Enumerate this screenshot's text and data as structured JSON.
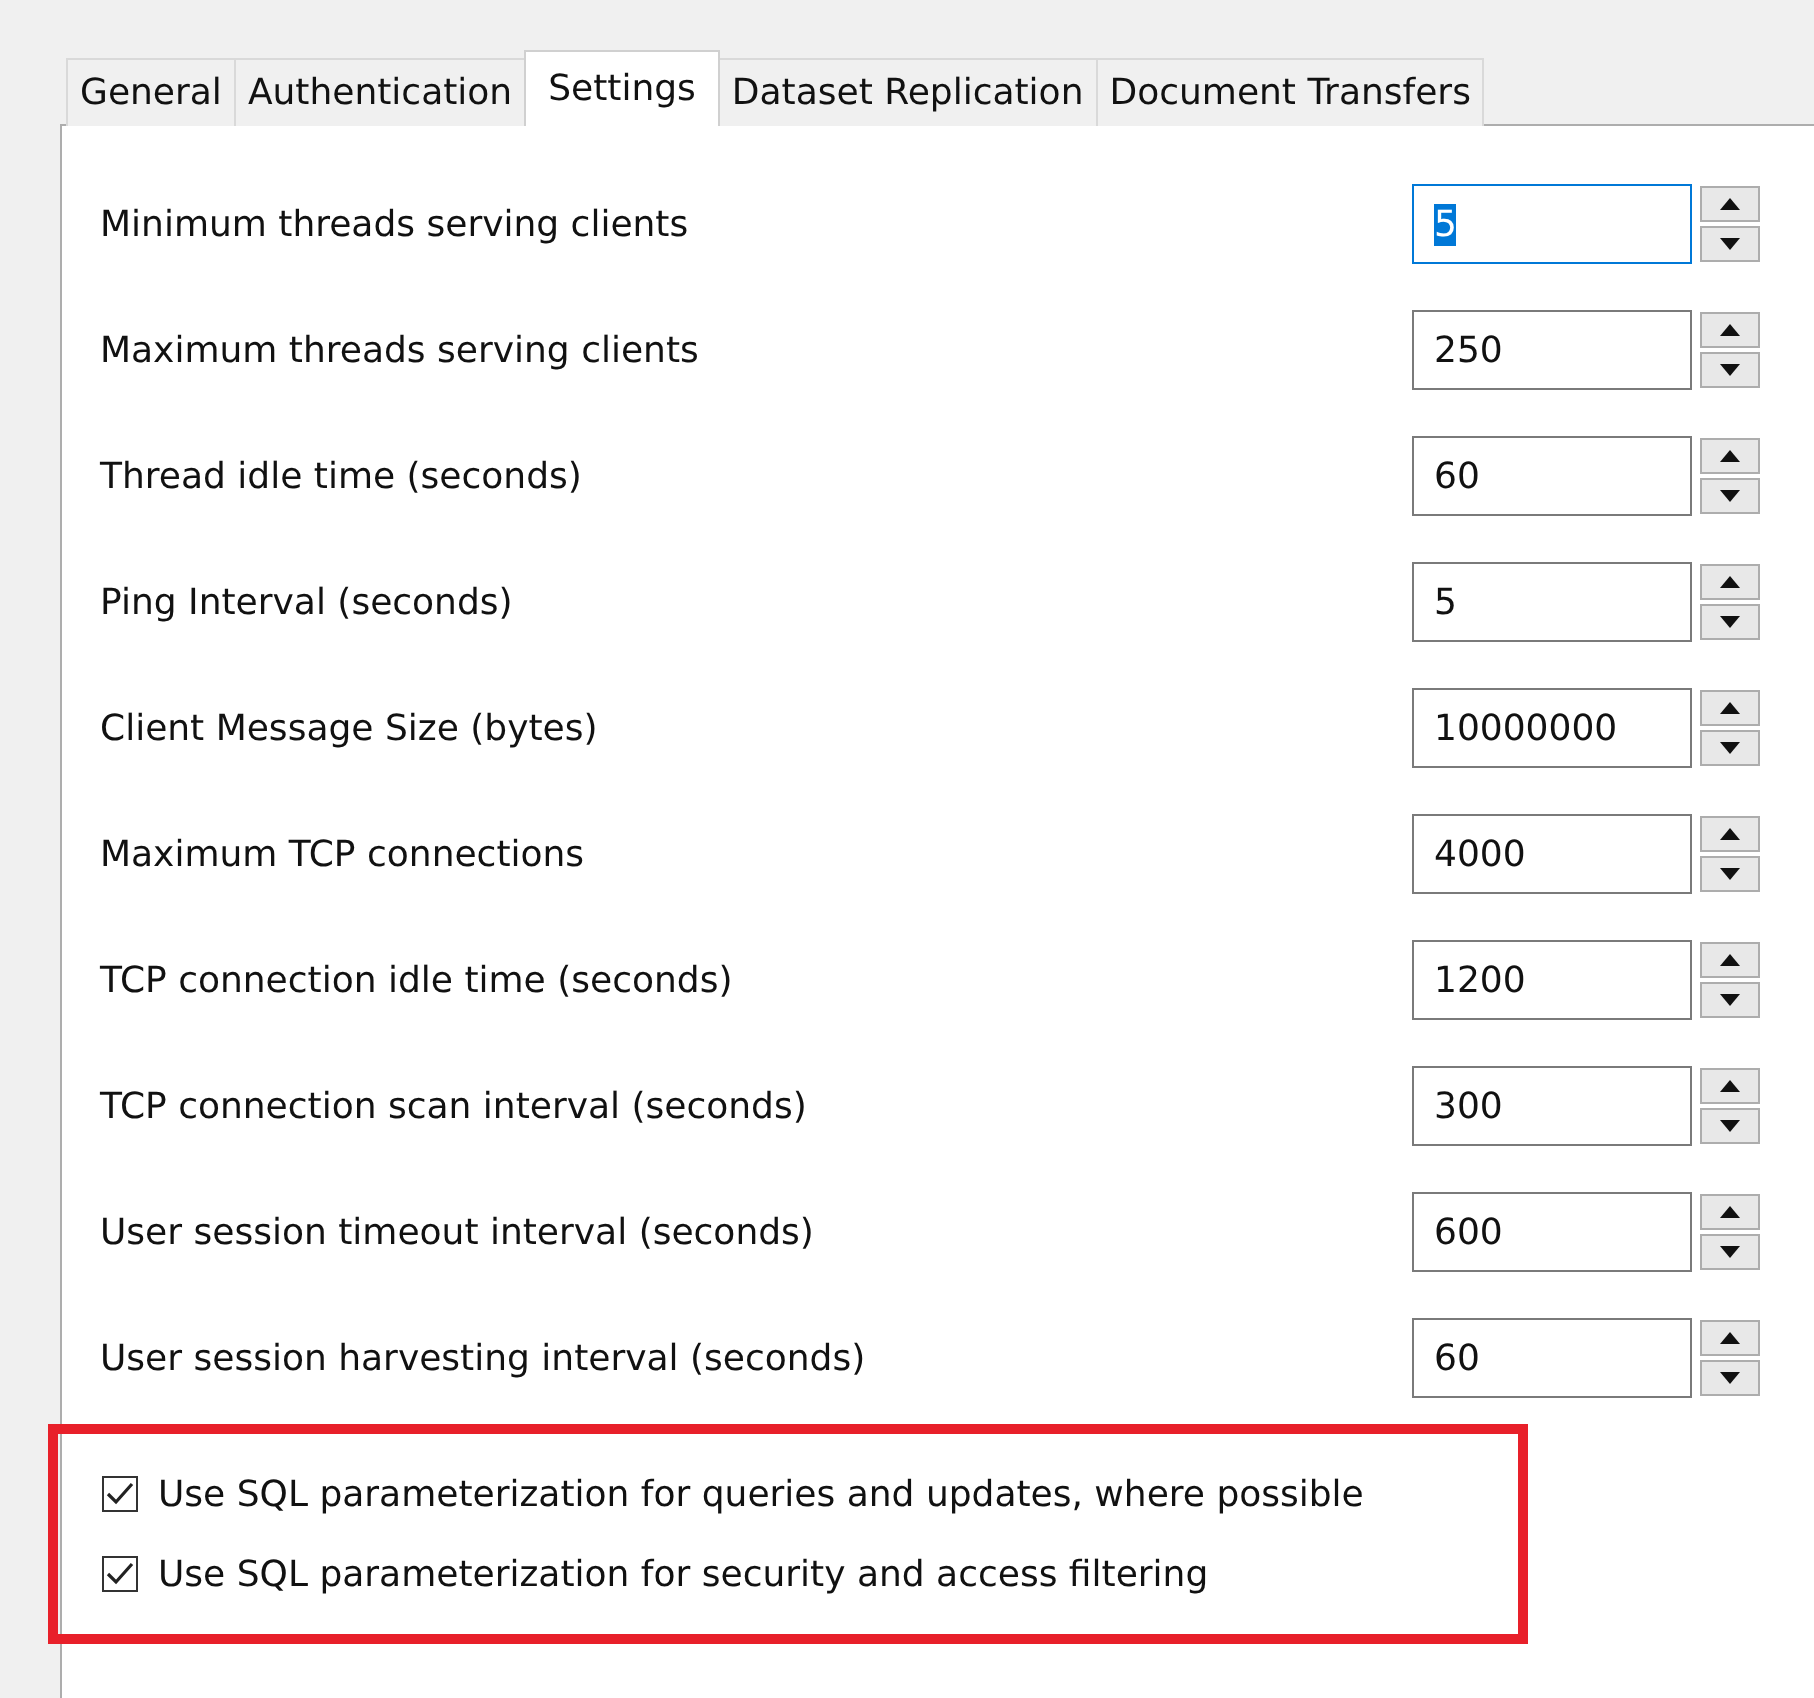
{
  "tabs": [
    {
      "label": "General",
      "selected": false
    },
    {
      "label": "Authentication",
      "selected": false
    },
    {
      "label": "Settings",
      "selected": true
    },
    {
      "label": "Dataset Replication",
      "selected": false
    },
    {
      "label": "Document Transfers",
      "selected": false
    }
  ],
  "settings": [
    {
      "label": "Minimum threads serving clients",
      "value": "5",
      "focused": true
    },
    {
      "label": "Maximum threads serving clients",
      "value": "250",
      "focused": false
    },
    {
      "label": "Thread idle time (seconds)",
      "value": "60",
      "focused": false
    },
    {
      "label": "Ping Interval (seconds)",
      "value": "5",
      "focused": false
    },
    {
      "label": "Client Message Size (bytes)",
      "value": "10000000",
      "focused": false
    },
    {
      "label": "Maximum TCP connections",
      "value": "4000",
      "focused": false
    },
    {
      "label": "TCP connection idle time (seconds)",
      "value": "1200",
      "focused": false
    },
    {
      "label": "TCP connection scan interval (seconds)",
      "value": "300",
      "focused": false
    },
    {
      "label": "User session timeout interval (seconds)",
      "value": "600",
      "focused": false
    },
    {
      "label": "User session harvesting interval (seconds)",
      "value": "60",
      "focused": false
    }
  ],
  "options": {
    "highlighted": true,
    "items": [
      {
        "label": "Use SQL parameterization for queries and updates, where possible",
        "checked": true
      },
      {
        "label": "Use SQL parameterization for security and access filtering",
        "checked": true
      }
    ]
  }
}
